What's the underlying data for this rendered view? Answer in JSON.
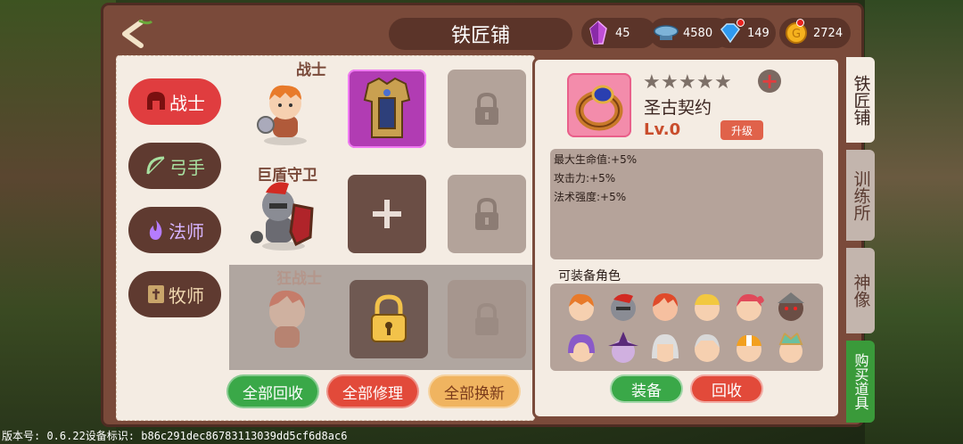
{
  "header": {
    "title": "铁匠铺",
    "resources": [
      {
        "icon": "purple-crystal-icon",
        "value": "45"
      },
      {
        "icon": "airship-icon",
        "value": "4580"
      },
      {
        "icon": "diamond-icon",
        "value": "149"
      },
      {
        "icon": "gold-coin-icon",
        "value": "2724"
      }
    ]
  },
  "classes": [
    {
      "label": "战士",
      "icon": "warrior-helmet-icon",
      "active": true
    },
    {
      "label": "弓手",
      "icon": "bow-icon",
      "active": false
    },
    {
      "label": "法师",
      "icon": "flame-icon",
      "active": false
    },
    {
      "label": "牧师",
      "icon": "holy-book-icon",
      "active": false
    }
  ],
  "heroes": [
    {
      "name": "战士",
      "locked": false
    },
    {
      "name": "巨盾守卫",
      "locked": false
    },
    {
      "name": "狂战士",
      "locked": true
    }
  ],
  "bottom_buttons": {
    "recycle_all": "全部回收",
    "repair_all": "全部修理",
    "replace_all": "全部换新"
  },
  "item": {
    "name": "圣古契约",
    "level": "Lv.0",
    "stars": 5,
    "upgrade_label": "升级",
    "stats": [
      "最大生命值:+5%",
      "攻击力:+5%",
      "法术强度:+5%"
    ],
    "equippable_title": "可装备角色",
    "equip_label": "装备",
    "recycle_label": "回收"
  },
  "side_tabs": [
    {
      "label": "铁匠铺",
      "active": true
    },
    {
      "label": "训练所",
      "active": false
    },
    {
      "label": "神像",
      "active": false
    },
    {
      "label": "购买道具",
      "active": false
    }
  ],
  "footer": {
    "text": "版本号: 0.6.22设备标识: b86c291dec86783113039dd5cf6d8ac6"
  },
  "colors": {
    "frame": "#7a4a3a",
    "active_tab": "#e03d3f",
    "green_button": "#3aa848",
    "red_button": "#e24a3a"
  }
}
